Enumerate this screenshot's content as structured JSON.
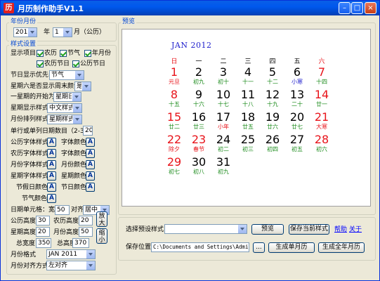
{
  "window": {
    "title": "月历制作助手V1.1",
    "icon_char": "历"
  },
  "year_month": {
    "legend": "年份月份",
    "year_value": "2012",
    "year_label": "年",
    "month_value": "1",
    "month_label": "月（公历）"
  },
  "style": {
    "legend": "样式设置",
    "show_items_label": "显示项目",
    "checks": [
      "农历",
      "节气",
      "年月份",
      "农历节日",
      "公历节日"
    ],
    "holiday_priority_label": "节日显示优先",
    "holiday_priority_value": "节气",
    "weekend_red_label": "星期六是否显示周末颜色",
    "weekend_red_value": "是",
    "week_start_label": "一星期的开始为",
    "week_start_value": "星期日",
    "week_display_label": "星期显示样式",
    "week_display_value": "中文样式",
    "month_layout_label": "月份排列样式",
    "month_layout_value": "星期样式",
    "rows_label": "单行或单列日期数目（2-31）",
    "rows_value": "20",
    "fonts": [
      {
        "left": "公历字体样式",
        "right": "字体颜色"
      },
      {
        "left": "农历字体样式",
        "right": "字体颜色"
      },
      {
        "left": "月份字体样式",
        "right": "月份颜色"
      },
      {
        "left": "星期字体样式",
        "right": "星期颜色"
      },
      {
        "left": "节假日颜色",
        "right": "节日颜色"
      }
    ],
    "solar_term_color_label": "节气颜色",
    "a_glyph": "A",
    "cell_label": "日期单元格：宽度",
    "cell_width": "50",
    "align_label": "对齐",
    "align_value": "居中",
    "solar_height_label": "公历高度",
    "solar_height": "30",
    "lunar_height_label": "农历高度",
    "lunar_height": "20",
    "week_height_label": "星期高度",
    "week_height": "20",
    "month_height_label": "月份高度",
    "month_height": "50",
    "total_width_label": "总宽度",
    "total_width": "350",
    "total_height_label": "总高度",
    "total_height": "370",
    "enlarge_label": "放大",
    "shrink_label": "缩小",
    "month_format_label": "月份格式",
    "month_format_value": "JAN 2011",
    "month_align_label": "月份对齐方式",
    "month_align_value": "左对齐"
  },
  "preview": {
    "legend": "预览",
    "month_title": "JAN 2012",
    "weekdays": [
      "日",
      "一",
      "二",
      "三",
      "四",
      "五",
      "六"
    ],
    "weeks": [
      [
        {
          "d": "1",
          "l": "元旦",
          "c": "red",
          "lc": "red"
        },
        {
          "d": "2",
          "l": "初九",
          "c": "black",
          "lc": "green"
        },
        {
          "d": "3",
          "l": "初十",
          "c": "black",
          "lc": "green"
        },
        {
          "d": "4",
          "l": "十一",
          "c": "black",
          "lc": "green"
        },
        {
          "d": "5",
          "l": "十二",
          "c": "black",
          "lc": "green"
        },
        {
          "d": "6",
          "l": "小寒",
          "c": "black",
          "lc": "blue"
        },
        {
          "d": "7",
          "l": "十四",
          "c": "red",
          "lc": "green"
        }
      ],
      [
        {
          "d": "8",
          "l": "十五",
          "c": "red",
          "lc": "green"
        },
        {
          "d": "9",
          "l": "十六",
          "c": "black",
          "lc": "green"
        },
        {
          "d": "10",
          "l": "十七",
          "c": "black",
          "lc": "green"
        },
        {
          "d": "11",
          "l": "十八",
          "c": "black",
          "lc": "green"
        },
        {
          "d": "12",
          "l": "十九",
          "c": "black",
          "lc": "green"
        },
        {
          "d": "13",
          "l": "二十",
          "c": "black",
          "lc": "green"
        },
        {
          "d": "14",
          "l": "廿一",
          "c": "red",
          "lc": "green"
        }
      ],
      [
        {
          "d": "15",
          "l": "廿二",
          "c": "red",
          "lc": "green"
        },
        {
          "d": "16",
          "l": "廿三",
          "c": "black",
          "lc": "green"
        },
        {
          "d": "17",
          "l": "小年",
          "c": "black",
          "lc": "red"
        },
        {
          "d": "18",
          "l": "廿五",
          "c": "black",
          "lc": "green"
        },
        {
          "d": "19",
          "l": "廿六",
          "c": "black",
          "lc": "green"
        },
        {
          "d": "20",
          "l": "廿七",
          "c": "black",
          "lc": "green"
        },
        {
          "d": "21",
          "l": "大寒",
          "c": "red",
          "lc": "red"
        }
      ],
      [
        {
          "d": "22",
          "l": "除夕",
          "c": "red",
          "lc": "red"
        },
        {
          "d": "23",
          "l": "春节",
          "c": "red",
          "lc": "red"
        },
        {
          "d": "24",
          "l": "初二",
          "c": "black",
          "lc": "green"
        },
        {
          "d": "25",
          "l": "初三",
          "c": "black",
          "lc": "green"
        },
        {
          "d": "26",
          "l": "初四",
          "c": "black",
          "lc": "green"
        },
        {
          "d": "27",
          "l": "初五",
          "c": "black",
          "lc": "green"
        },
        {
          "d": "28",
          "l": "初六",
          "c": "red",
          "lc": "green"
        }
      ],
      [
        {
          "d": "29",
          "l": "初七",
          "c": "red",
          "lc": "green"
        },
        {
          "d": "30",
          "l": "初八",
          "c": "black",
          "lc": "green"
        },
        {
          "d": "31",
          "l": "初九",
          "c": "black",
          "lc": "green"
        }
      ]
    ]
  },
  "bottom": {
    "preset_label": "选择预设样式",
    "preset_value": "",
    "preview_button": "预览",
    "save_style_button": "保存当前样式",
    "help_link": "帮助",
    "about_link": "关于",
    "save_location_label": "保存位置",
    "save_path": "C:\\Documents and Settings\\Administ",
    "browse_button": "...",
    "gen_month_button": "生成单月历",
    "gen_year_button": "生成全年月历"
  },
  "colors": {
    "red": "#e8141b",
    "green": "#1a8a1a",
    "blue": "#1c1ccc",
    "black": "#000000"
  }
}
